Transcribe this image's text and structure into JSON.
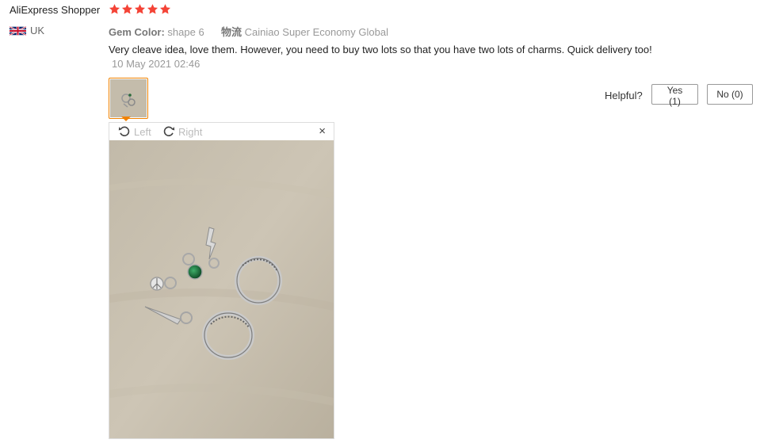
{
  "review": {
    "author": "AliExpress Shopper",
    "rating": 5,
    "country": "UK",
    "attributes": {
      "gem_color_label": "Gem Color:",
      "gem_color_value": "shape 6",
      "shipping_label": "物流",
      "shipping_value": "Cainiao Super Economy Global"
    },
    "text": "Very cleave idea, love them. However, you need to buy two lots so that you have two lots of charms. Quick delivery too!",
    "date": "10 May 2021 02:46"
  },
  "helpful": {
    "label": "Helpful?",
    "yes_label": "Yes (1)",
    "no_label": "No (0)"
  },
  "viewer": {
    "rotate_left_label": "Left",
    "rotate_right_label": "Right",
    "close_glyph": "×"
  },
  "colors": {
    "star": "#f44336",
    "thumb_border": "#f08200",
    "table_surface": "#c8c0b0"
  },
  "icons": {
    "rotate_left": "rotate-left-icon",
    "rotate_right": "rotate-right-icon",
    "close": "close-icon",
    "flag": "uk-flag-icon"
  }
}
